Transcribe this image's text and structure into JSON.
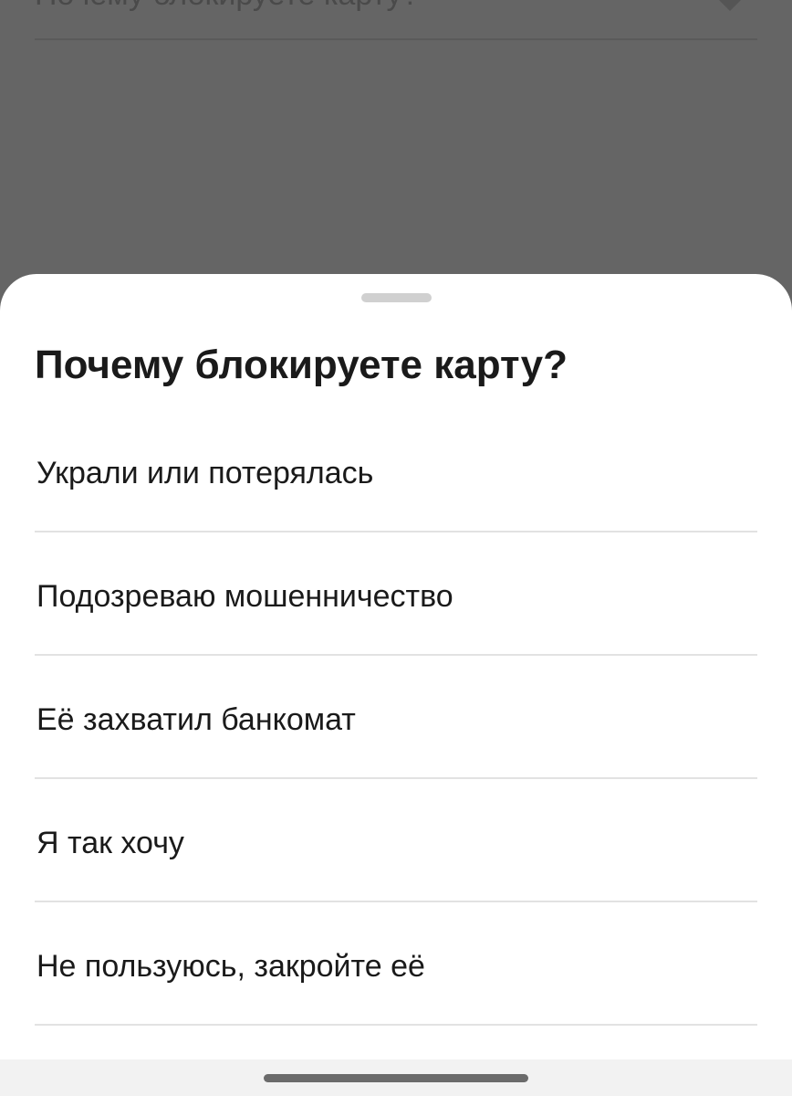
{
  "background": {
    "select_text": "Почему блокируете карту?",
    "arrow_icon": "triangle-down-icon"
  },
  "sheet": {
    "title": "Почему блокируете карту?",
    "options": [
      {
        "label": "Украли или потерялась"
      },
      {
        "label": "Подозреваю мошенничество"
      },
      {
        "label": "Её захватил банкомат"
      },
      {
        "label": "Я так хочу"
      },
      {
        "label": "Не пользуюсь, закройте её"
      }
    ]
  },
  "colors": {
    "overlay": "#656565",
    "sheet_bg": "#ffffff",
    "text": "#1a1a1a",
    "divider": "#e2e2e2"
  }
}
